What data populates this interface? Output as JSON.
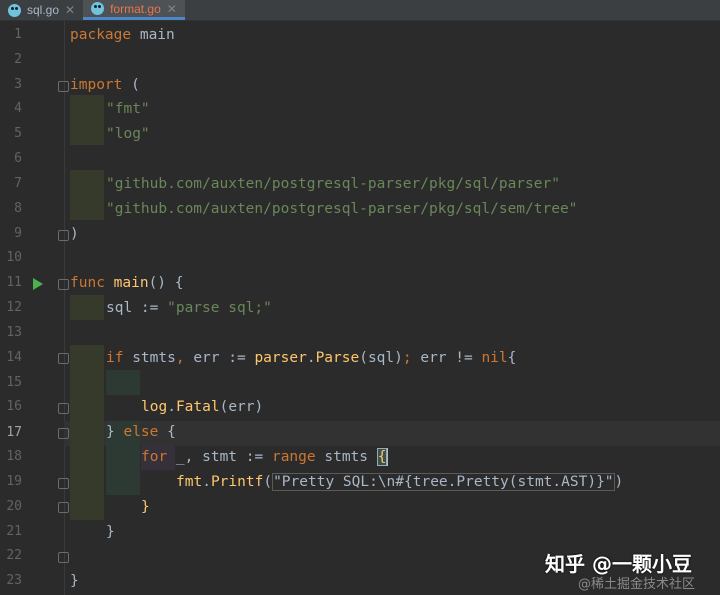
{
  "tabs": [
    {
      "label": "sql.go",
      "active": false
    },
    {
      "label": "format.go",
      "active": true
    }
  ],
  "close_glyph": "✕",
  "line_numbers": [
    "1",
    "2",
    "3",
    "4",
    "5",
    "6",
    "7",
    "8",
    "9",
    "10",
    "11",
    "12",
    "13",
    "14",
    "15",
    "16",
    "17",
    "18",
    "19",
    "20",
    "21",
    "22",
    "23"
  ],
  "code": {
    "l1_kw": "package",
    "l1_rest": " main",
    "l3_kw": "import",
    "l3_rest": " (",
    "l4": "\"fmt\"",
    "l5": "\"log\"",
    "l7": "\"github.com/auxten/postgresql-parser/pkg/sql/parser\"",
    "l8": "\"github.com/auxten/postgresql-parser/pkg/sql/sem/tree\"",
    "l9": ")",
    "l11_kw": "func",
    "l11_fn": "main",
    "l11_rest": "() {",
    "l12_a": "sql := ",
    "l12_str": "\"parse sql;\"",
    "l14_kw": "if",
    "l14_a": " stmts",
    "l14_comma": ",",
    "l14_b": " err := ",
    "l14_pkg": "parser",
    "l14_dot": ".",
    "l14_fn": "Parse",
    "l14_c": "(sql)",
    "l14_semi": ";",
    "l14_d": " err != ",
    "l14_nil": "nil",
    "l14_e": "{",
    "l15_pkg": "log",
    "l15_dot": ".",
    "l15_fn": "Fatal",
    "l15_rest": "(err)",
    "l16_a": "} ",
    "l16_kw": "else",
    "l16_rest": " {",
    "l17_kw": "for",
    "l17_a": " _, stmt := ",
    "l17_kw2": "range",
    "l17_b": " stmts ",
    "l17_brace": "{",
    "l18_pkg": "fmt",
    "l18_dot": ".",
    "l18_fn": "Printf",
    "l18_paren": "(",
    "l18_str": "\"Pretty SQL:\\n#{tree.Pretty(stmt.AST)}\"",
    "l18_end": ")",
    "l19": "}",
    "l20": "}",
    "l22": "}"
  },
  "watermark": {
    "main": "知乎 @一颗小豆",
    "sub": "@稀土掘金技术社区"
  },
  "colors": {
    "keyword": "#cc7832",
    "string": "#6a8759",
    "function": "#ffc66d",
    "text": "#a9b7c6",
    "background": "#2b2b2b"
  }
}
